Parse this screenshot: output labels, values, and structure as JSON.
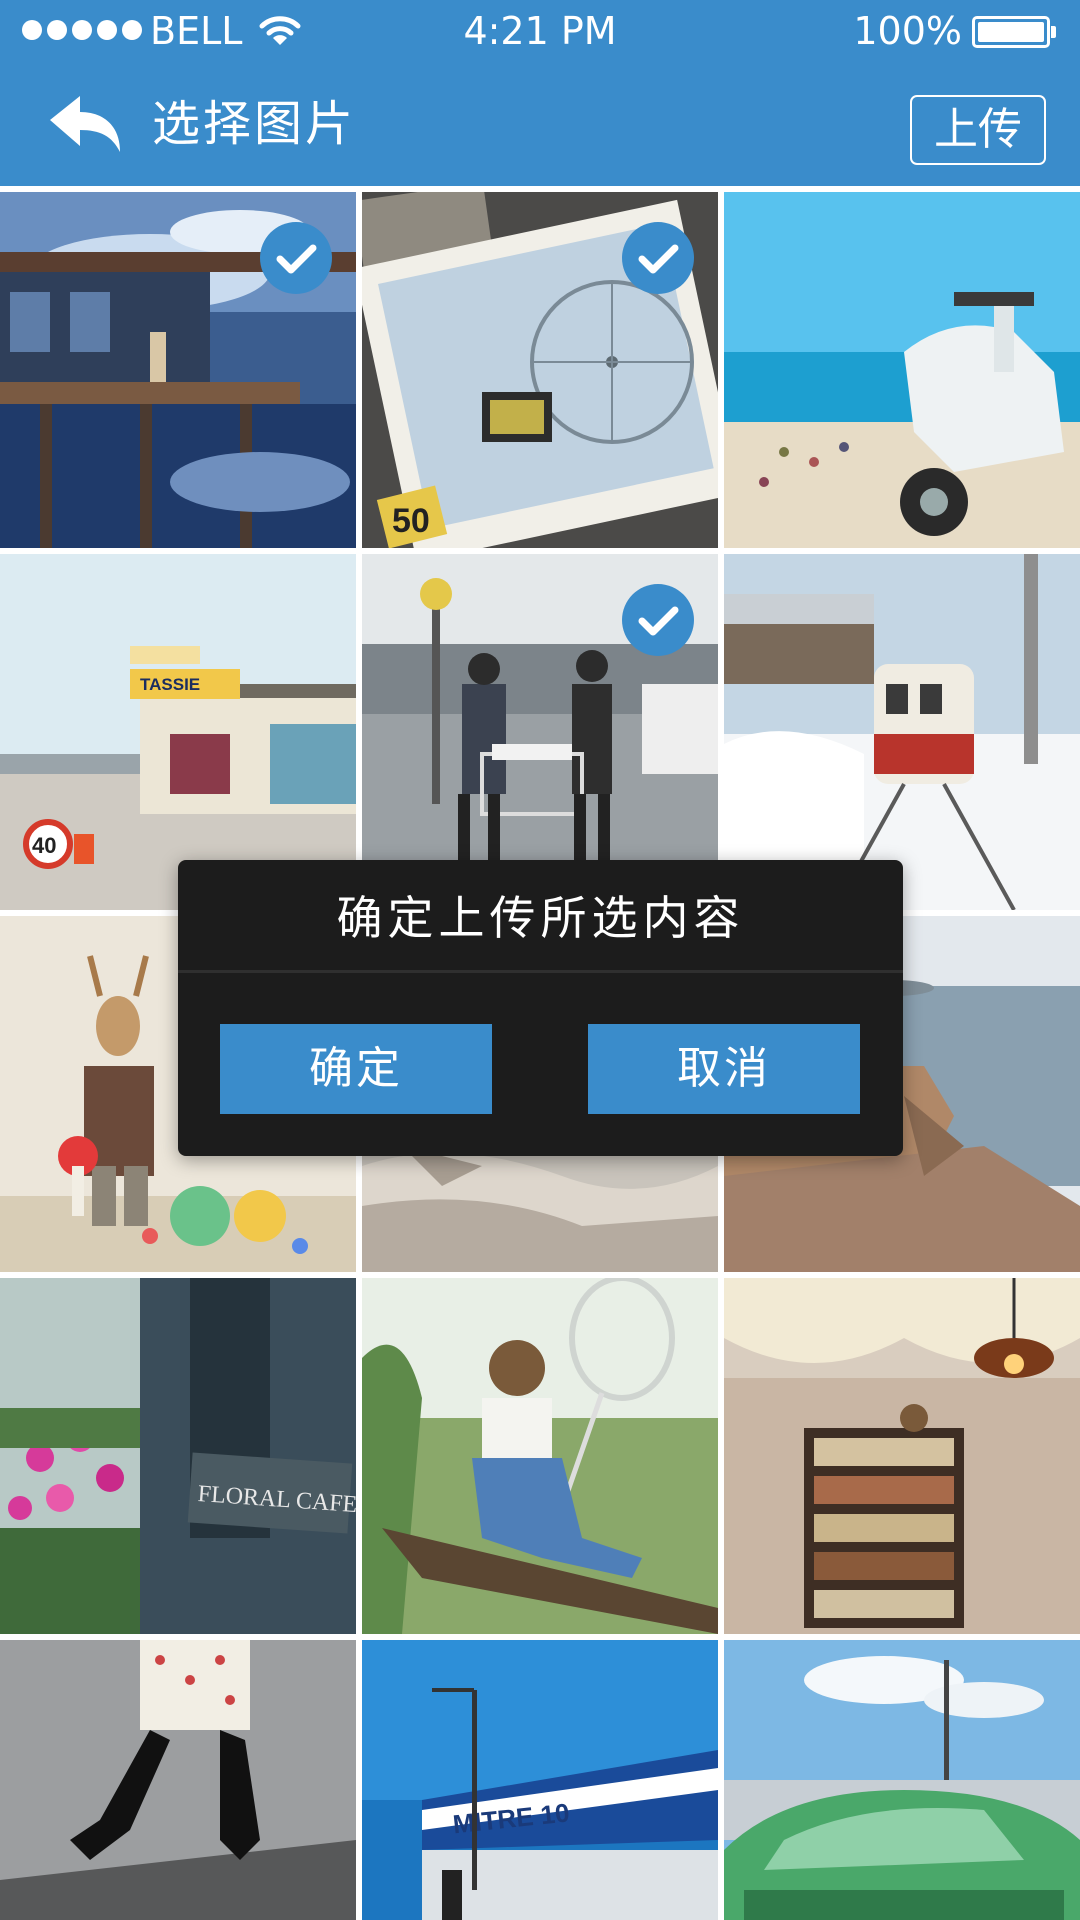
{
  "status_bar": {
    "carrier": "BELL",
    "time": "4:21 PM",
    "battery": "100%"
  },
  "nav": {
    "title": "选择图片",
    "upload_label": "上传"
  },
  "photos": [
    {
      "subject": "anime girl on wooden pier over water",
      "selected": true
    },
    {
      "subject": "ferris wheel postcard photos",
      "selected": true
    },
    {
      "subject": "white scooter by the beach",
      "selected": false
    },
    {
      "subject": "street with TASSIE SOUVENIRS shop",
      "selected": false
    },
    {
      "subject": "couple pushing shopping cart",
      "selected": true
    },
    {
      "subject": "train at snowy station",
      "selected": false
    },
    {
      "subject": "person wearing deer mask",
      "selected": false
    },
    {
      "subject": "rocky shoreline",
      "selected": false
    },
    {
      "subject": "coastal cliffs and sea",
      "selected": false
    },
    {
      "subject": "pink flowers by FLORAL CAFE door",
      "selected": false
    },
    {
      "subject": "girl with butterfly net on branch",
      "selected": false
    },
    {
      "subject": "room with bookshelf and lamp",
      "selected": false
    },
    {
      "subject": "legs in knee socks walking",
      "selected": false
    },
    {
      "subject": "MITRE 10 store sign",
      "selected": false
    },
    {
      "subject": "green vintage car",
      "selected": false
    }
  ],
  "dialog": {
    "message": "确定上传所选内容",
    "confirm_label": "确定",
    "cancel_label": "取消"
  },
  "colors": {
    "brand_blue": "#3a8ccb",
    "dialog_bg": "#1c1c1c"
  }
}
